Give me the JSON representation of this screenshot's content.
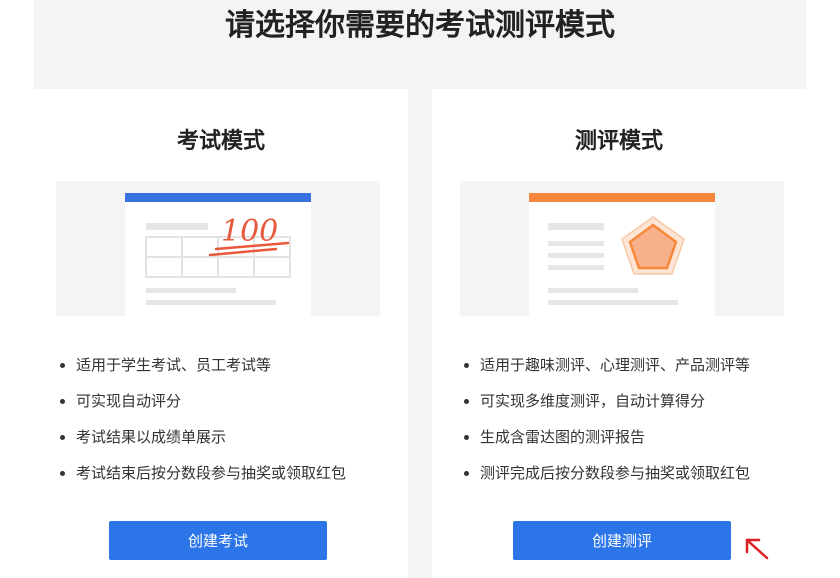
{
  "page_title": "请选择你需要的考试测评模式",
  "modes": [
    {
      "title": "考试模式",
      "features": [
        "适用于学生考试、员工考试等",
        "可实现自动评分",
        "考试结果以成绩单展示",
        "考试结束后按分数段参与抽奖或领取红包"
      ],
      "button_label": "创建考试",
      "illustration": {
        "score_text": "100",
        "accent_color": "#3a73e0",
        "mark_color": "#e8583a"
      }
    },
    {
      "title": "测评模式",
      "features": [
        "适用于趣味测评、心理测评、产品测评等",
        "可实现多维度测评，自动计算得分",
        "生成含雷达图的测评报告",
        "测评完成后按分数段参与抽奖或领取红包"
      ],
      "button_label": "创建测评",
      "illustration": {
        "accent_color": "#f5883a",
        "radar_color": "#f7b08a"
      }
    }
  ],
  "colors": {
    "primary_button": "#2b75e8",
    "panel_bg": "#f4f4f4",
    "pointer_arrow": "#e02020"
  },
  "icons": {
    "pointer": "red-arrow-icon"
  }
}
